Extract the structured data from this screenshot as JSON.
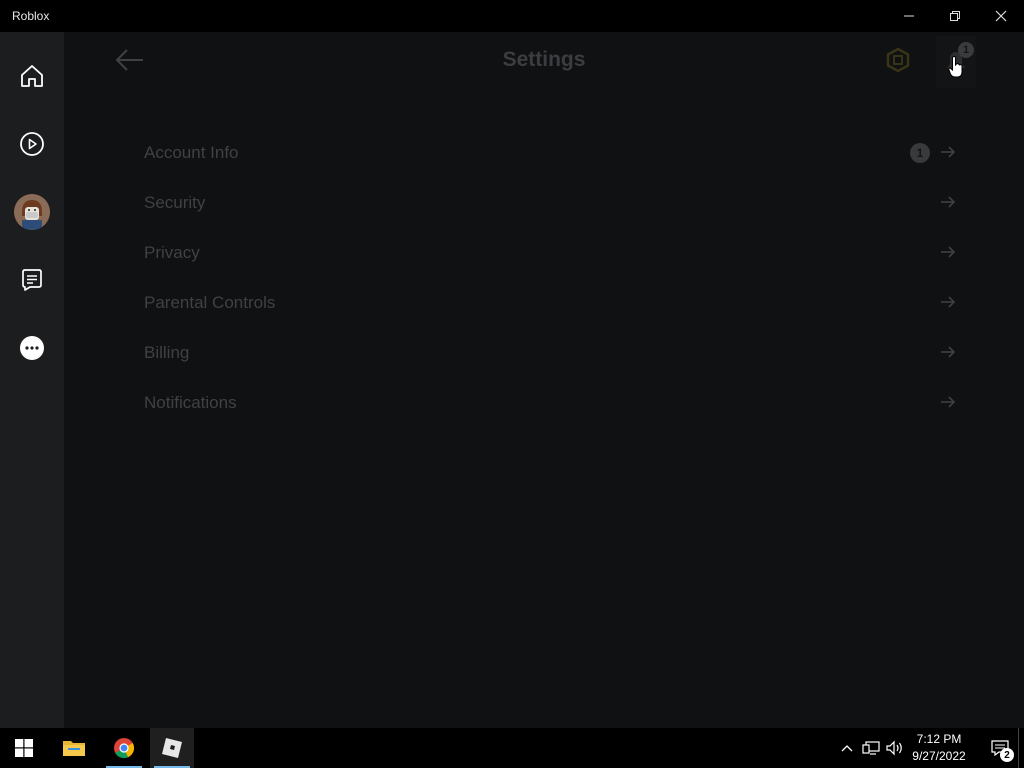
{
  "window": {
    "title": "Roblox",
    "controls": [
      "minimize",
      "restore",
      "close"
    ]
  },
  "sidebar": {
    "items": [
      {
        "name": "home",
        "icon": "home-icon"
      },
      {
        "name": "discover",
        "icon": "play-icon"
      },
      {
        "name": "avatar",
        "icon": "avatar-icon"
      },
      {
        "name": "chat",
        "icon": "chat-icon"
      },
      {
        "name": "more",
        "icon": "more-icon"
      }
    ]
  },
  "header": {
    "title": "Settings",
    "notification_count": "1"
  },
  "settings": {
    "items": [
      {
        "label": "Account Info",
        "badge": "1"
      },
      {
        "label": "Security"
      },
      {
        "label": "Privacy"
      },
      {
        "label": "Parental Controls"
      },
      {
        "label": "Billing"
      },
      {
        "label": "Notifications"
      }
    ]
  },
  "taskbar": {
    "apps": [
      "start-icon",
      "file-explorer-icon",
      "chrome-icon",
      "roblox-icon"
    ],
    "clock": {
      "time": "7:12 PM",
      "date": "9/27/2022"
    },
    "action_center_count": "2"
  },
  "colors": {
    "sidebar_bg": "#1c1d1e",
    "main_bg": "#101112",
    "dim_text": "#3f4144",
    "taskbar_bg": "#000000",
    "taskbar_accent": "#76b9ed"
  }
}
